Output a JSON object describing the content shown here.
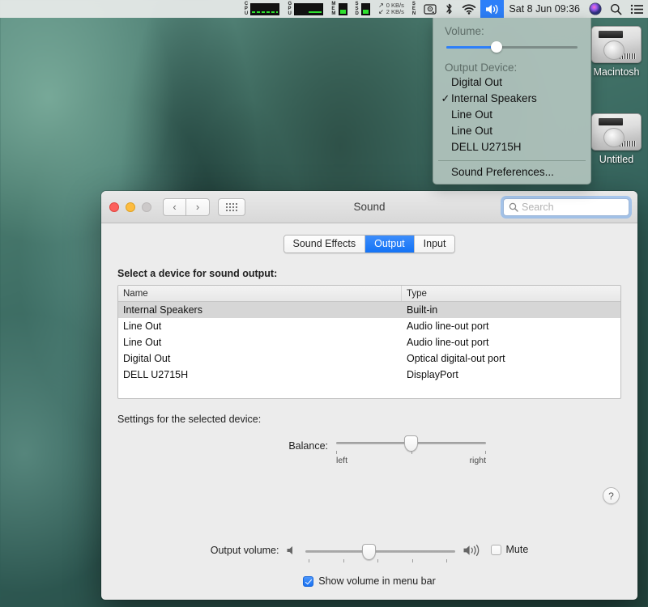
{
  "menubar": {
    "monitors": [
      {
        "name": "CPU",
        "label": "CPU",
        "kind": "graph"
      },
      {
        "name": "GPU",
        "label": "GPU",
        "kind": "graph"
      },
      {
        "name": "MEM",
        "label": "MEM",
        "kind": "bar"
      },
      {
        "name": "SSD",
        "label": "SSD",
        "kind": "bar"
      }
    ],
    "network": {
      "up_arrow": "↗",
      "down_arrow": "↙",
      "up_rate": "0 KB/s",
      "down_rate": "2 KB/s"
    },
    "sensors_label": "SEN",
    "disk_icon": "disk-icon",
    "bluetooth_icon": "bluetooth-icon",
    "wifi_icon": "wifi-icon",
    "volume_icon": "volume-icon",
    "clock": "Sat 8 Jun  09:36",
    "siri_icon": "siri-icon",
    "spotlight_icon": "spotlight-icon",
    "notification_icon": "notification-center-icon"
  },
  "volume_menu": {
    "volume_caption": "Volume:",
    "volume_percent": 38,
    "output_caption": "Output Device:",
    "devices": [
      {
        "label": "Digital Out",
        "checked": false
      },
      {
        "label": "Internal Speakers",
        "checked": true
      },
      {
        "label": "Line Out",
        "checked": false
      },
      {
        "label": "Line Out",
        "checked": false
      },
      {
        "label": "DELL U2715H",
        "checked": false
      }
    ],
    "check_glyph": "✓",
    "preferences_label": "Sound Preferences..."
  },
  "desktop": {
    "drives": [
      {
        "label": "Macintosh"
      },
      {
        "label": "Untitled"
      }
    ]
  },
  "window": {
    "title": "Sound",
    "back_glyph": "‹",
    "forward_glyph": "›",
    "grid_icon": "grid-view-icon",
    "search": {
      "placeholder": "Search",
      "value": "",
      "icon": "search-icon"
    },
    "tabs": [
      {
        "label": "Sound Effects",
        "selected": false
      },
      {
        "label": "Output",
        "selected": true
      },
      {
        "label": "Input",
        "selected": false
      }
    ],
    "device_section_label": "Select a device for sound output:",
    "table": {
      "columns": [
        "Name",
        "Type"
      ],
      "rows": [
        {
          "name": "Internal Speakers",
          "type": "Built-in",
          "selected": true
        },
        {
          "name": "Line Out",
          "type": "Audio line-out port",
          "selected": false
        },
        {
          "name": "Line Out",
          "type": "Audio line-out port",
          "selected": false
        },
        {
          "name": "Digital Out",
          "type": "Optical digital-out port",
          "selected": false
        },
        {
          "name": "DELL U2715H",
          "type": "DisplayPort",
          "selected": false
        }
      ]
    },
    "settings_section_label": "Settings for the selected device:",
    "balance": {
      "label": "Balance:",
      "left_label": "left",
      "right_label": "right",
      "value_percent": 50
    },
    "output_volume": {
      "label": "Output volume:",
      "value_percent": 42,
      "low_icon": "speaker-low-icon",
      "high_icon": "speaker-high-icon",
      "mute_label": "Mute",
      "mute_checked": false
    },
    "show_volume": {
      "label": "Show volume in menu bar",
      "checked": true
    },
    "help_label": "?"
  }
}
